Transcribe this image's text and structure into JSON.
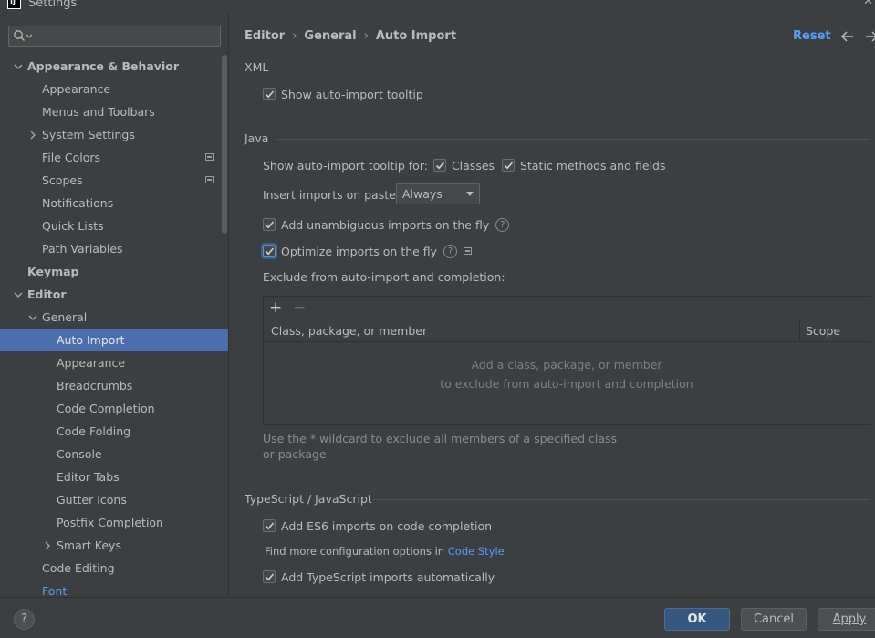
{
  "window": {
    "title": "Settings"
  },
  "search": {
    "placeholder": ""
  },
  "tree": [
    {
      "label": "Appearance & Behavior",
      "level": 0,
      "bold": true,
      "expanded": true
    },
    {
      "label": "Appearance",
      "level": 1
    },
    {
      "label": "Menus and Toolbars",
      "level": 1
    },
    {
      "label": "System Settings",
      "level": 1,
      "collapsed": true
    },
    {
      "label": "File Colors",
      "level": 1,
      "modified": true
    },
    {
      "label": "Scopes",
      "level": 1,
      "modified": true
    },
    {
      "label": "Notifications",
      "level": 1
    },
    {
      "label": "Quick Lists",
      "level": 1
    },
    {
      "label": "Path Variables",
      "level": 1
    },
    {
      "label": "Keymap",
      "level": 0,
      "bold": true
    },
    {
      "label": "Editor",
      "level": 0,
      "bold": true,
      "expanded": true
    },
    {
      "label": "General",
      "level": 1,
      "expanded": true
    },
    {
      "label": "Auto Import",
      "level": 2,
      "selected": true
    },
    {
      "label": "Appearance",
      "level": 2
    },
    {
      "label": "Breadcrumbs",
      "level": 2
    },
    {
      "label": "Code Completion",
      "level": 2
    },
    {
      "label": "Code Folding",
      "level": 2
    },
    {
      "label": "Console",
      "level": 2
    },
    {
      "label": "Editor Tabs",
      "level": 2
    },
    {
      "label": "Gutter Icons",
      "level": 2
    },
    {
      "label": "Postfix Completion",
      "level": 2
    },
    {
      "label": "Smart Keys",
      "level": 2,
      "collapsed": true
    },
    {
      "label": "Code Editing",
      "level": 1
    },
    {
      "label": "Font",
      "level": 1,
      "link": true
    }
  ],
  "breadcrumb": [
    "Editor",
    "General",
    "Auto Import"
  ],
  "header": {
    "reset_label": "Reset"
  },
  "xml": {
    "title": "XML",
    "show_tooltip": {
      "label": "Show auto-import tooltip",
      "checked": true
    }
  },
  "java": {
    "title": "Java",
    "show_tooltip_for_label": "Show auto-import tooltip for:",
    "classes": {
      "label": "Classes",
      "checked": true
    },
    "static_methods": {
      "label": "Static methods and fields",
      "checked": true
    },
    "insert_imports_label": "Insert imports on paste:",
    "insert_imports_value": "Always",
    "add_unambiguous": {
      "label": "Add unambiguous imports on the fly",
      "checked": true
    },
    "optimize_imports": {
      "label": "Optimize imports on the fly",
      "checked": true
    },
    "exclude_label": "Exclude from auto-import and completion:",
    "table": {
      "columns": [
        "Class, package, or member",
        "Scope"
      ],
      "empty_line1": "Add a class, package, or member",
      "empty_line2": "to exclude from auto-import and completion"
    },
    "hint": "Use the * wildcard to exclude all members of a specified class or package"
  },
  "ts": {
    "title": "TypeScript / JavaScript",
    "add_es6": {
      "label": "Add ES6 imports on code completion",
      "checked": true
    },
    "more_options_prefix": "Find more configuration options in",
    "more_options_link": "Code Style",
    "add_ts": {
      "label": "Add TypeScript imports automatically",
      "checked": true
    }
  },
  "footer": {
    "help": "?",
    "ok": "OK",
    "cancel": "Cancel",
    "apply": "Apply"
  }
}
